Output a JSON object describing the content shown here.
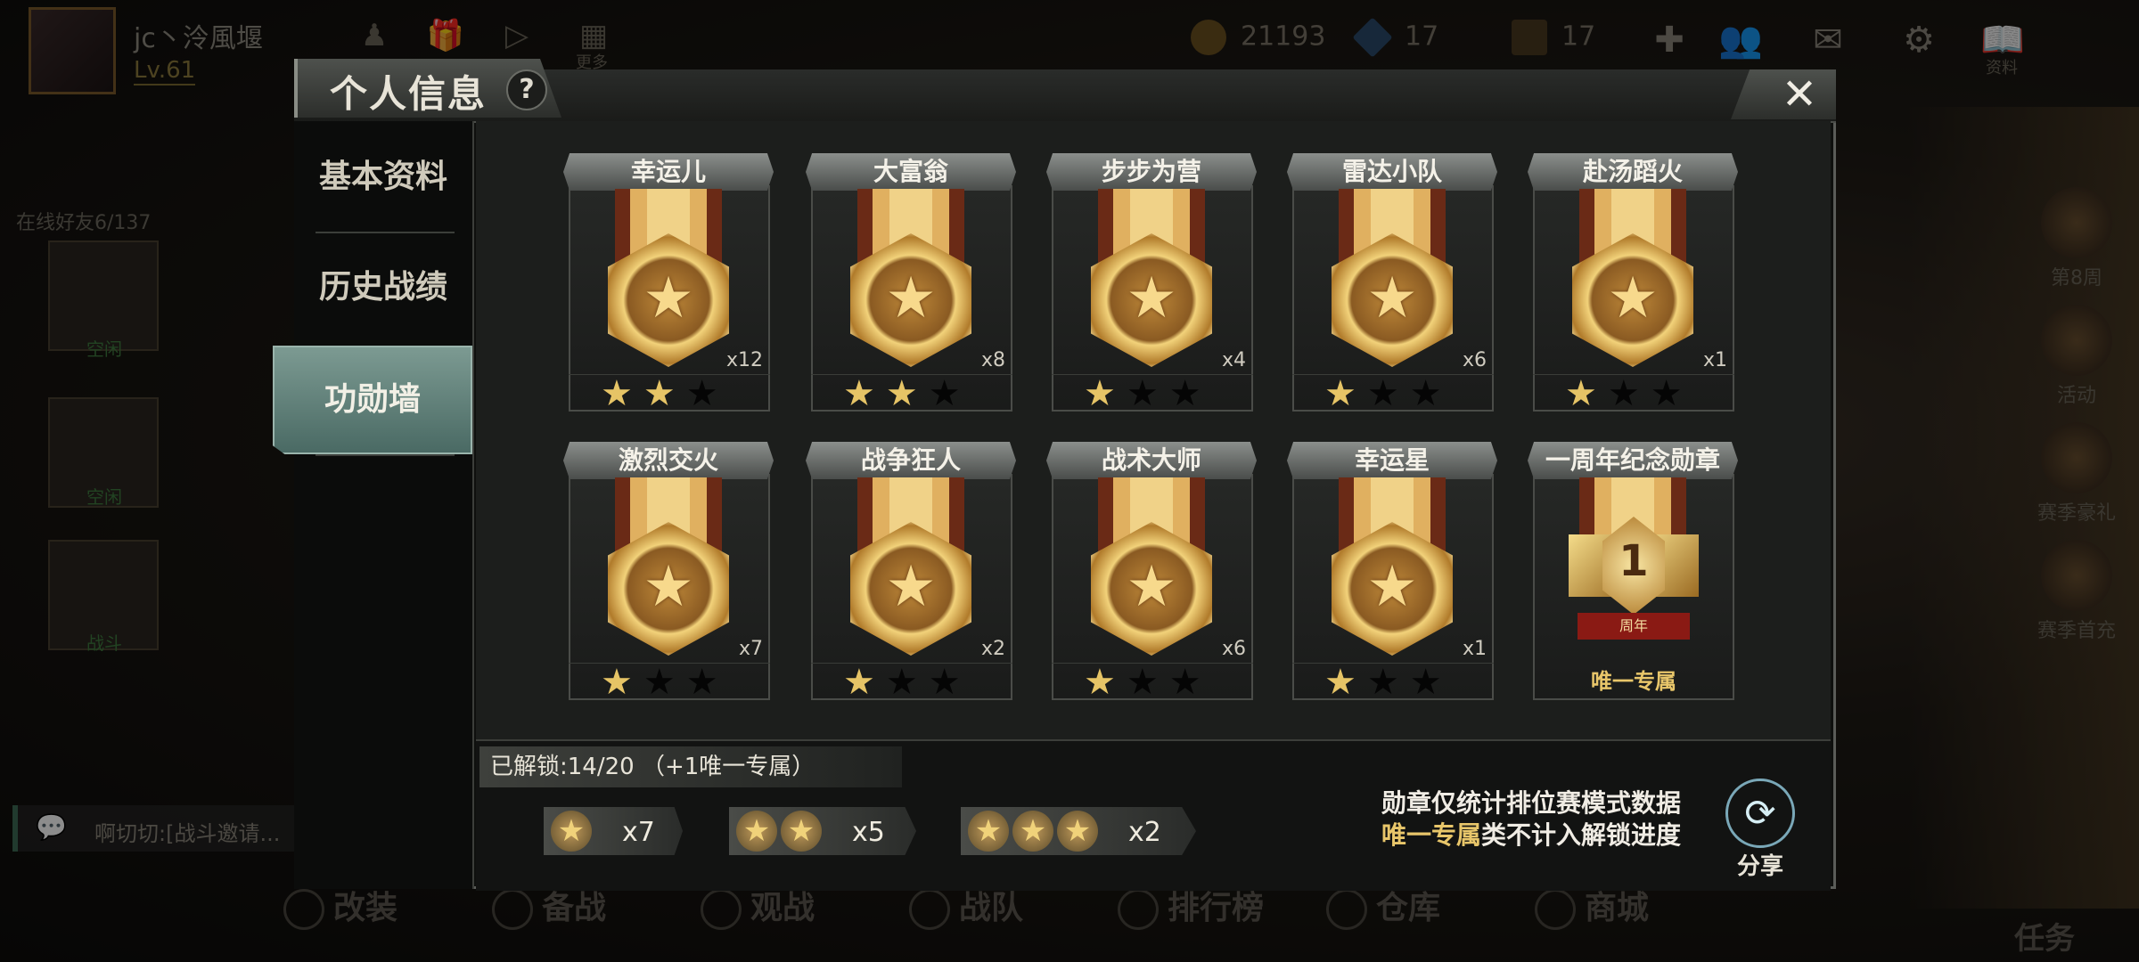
{
  "header": {
    "player_name": "jc丶泠風堰",
    "level": "Lv.61",
    "coins": "21193",
    "diamonds": "17",
    "tickets": "17",
    "more_label": "更多",
    "profile_label": "资料"
  },
  "social": {
    "friend_count": "在线好友6/137",
    "friend_labels": [
      "空闲",
      "空闲",
      "战斗"
    ],
    "chat_text": "啊切切:[战斗邀请..."
  },
  "right_side": [
    "第8周",
    "活动",
    "赛季豪礼",
    "赛季首充"
  ],
  "bottom_nav": [
    "改装",
    "备战",
    "观战",
    "战队",
    "排行榜",
    "仓库",
    "商城"
  ],
  "task_label": "任务",
  "dialog": {
    "title": "个人信息",
    "help_icon": "?",
    "close_icon": "✕",
    "menu": [
      "基本资料",
      "历史战绩",
      "功勋墙"
    ],
    "active_menu": "功勋墙"
  },
  "medals": [
    {
      "name": "幸运儿",
      "count": "x12",
      "stars": 2
    },
    {
      "name": "大富翁",
      "count": "x8",
      "stars": 2
    },
    {
      "name": "步步为营",
      "count": "x4",
      "stars": 1
    },
    {
      "name": "雷达小队",
      "count": "x6",
      "stars": 1
    },
    {
      "name": "赴汤蹈火",
      "count": "x1",
      "stars": 1
    },
    {
      "name": "激烈交火",
      "count": "x7",
      "stars": 1
    },
    {
      "name": "战争狂人",
      "count": "x2",
      "stars": 1
    },
    {
      "name": "战术大师",
      "count": "x6",
      "stars": 1
    },
    {
      "name": "幸运星",
      "count": "x1",
      "stars": 1
    },
    {
      "name": "一周年纪念勋章",
      "exclusive_label": "唯一专属",
      "badge_number": "1",
      "badge_text": "周年"
    }
  ],
  "summary": {
    "unlocked": "已解锁:14/20 （+1唯一专属）",
    "tiers": [
      {
        "stars": 1,
        "count": "x7"
      },
      {
        "stars": 2,
        "count": "x5"
      },
      {
        "stars": 3,
        "count": "x2"
      }
    ],
    "note_line1": "勋章仅统计排位赛模式数据",
    "note_line2_highlight": "唯一专属",
    "note_line2_rest": "类不计入解锁进度",
    "share_label": "分享"
  },
  "colors": {
    "accent_gold": "#e8c66a",
    "active_tab": "#6f8f88",
    "star_on": "#e6c466"
  }
}
